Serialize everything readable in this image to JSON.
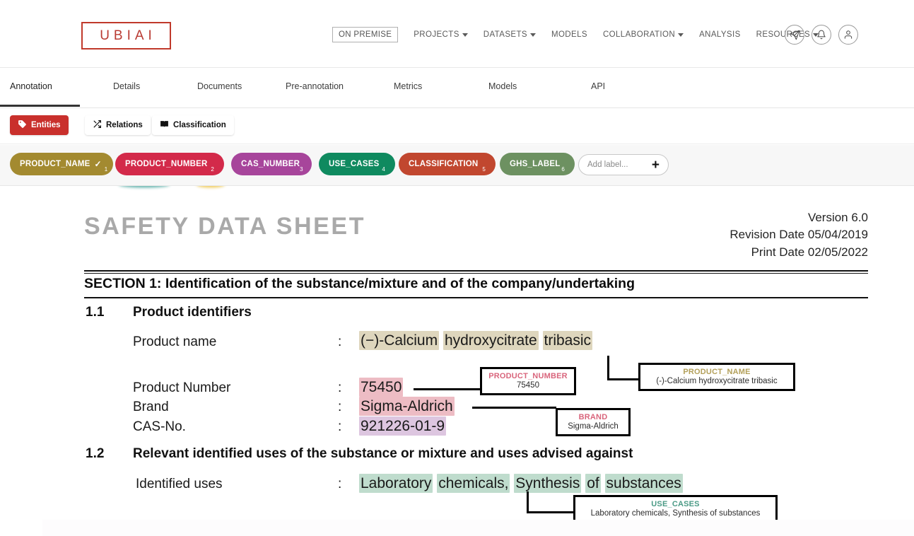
{
  "brand": {
    "name": "UBIAI",
    "color": "#b93b33"
  },
  "topnav": {
    "badge": "ON PREMISE",
    "items": [
      {
        "label": "PROJECTS",
        "caret": true
      },
      {
        "label": "DATASETS",
        "caret": true
      },
      {
        "label": "MODELS",
        "caret": false
      },
      {
        "label": "COLLABORATION",
        "caret": true
      },
      {
        "label": "ANALYSIS",
        "caret": false
      },
      {
        "label": "RESOURCES",
        "caret": true
      }
    ],
    "icons": [
      "send-icon",
      "bell-icon",
      "user-icon"
    ]
  },
  "tabs": {
    "items": [
      {
        "label": "Annotation",
        "active": true
      },
      {
        "label": "Details",
        "active": false
      },
      {
        "label": "Documents",
        "active": false
      },
      {
        "label": "Pre-annotation",
        "active": false
      },
      {
        "label": "Metrics",
        "active": false
      },
      {
        "label": "Models",
        "active": false
      },
      {
        "label": "API",
        "active": false
      }
    ]
  },
  "modebar": {
    "entities": "Entities",
    "relations": "Relations",
    "classification": "Classification"
  },
  "labels": {
    "chips": [
      {
        "name": "PRODUCT_NAME",
        "num": "1",
        "color": "#a38a30",
        "check": "✓"
      },
      {
        "name": "PRODUCT_NUMBER",
        "num": "2",
        "color": "#d32a4a",
        "check": ""
      },
      {
        "name": "CAS_NUMBER",
        "num": "3",
        "color": "#a7459b",
        "check": ""
      },
      {
        "name": "USE_CASES",
        "num": "4",
        "color": "#0f8a5f",
        "check": ""
      },
      {
        "name": "CLASSIFICATION",
        "num": "5",
        "color": "#c1472f",
        "check": ""
      },
      {
        "name": "GHS_LABEL",
        "num": "6",
        "color": "#6d9161",
        "check": ""
      }
    ],
    "add_placeholder": "Add label...",
    "add_plus": "+"
  },
  "document": {
    "title": "SAFETY DATA SHEET",
    "version": "Version 6.0",
    "revision_date": "Revision Date 05/04/2019",
    "print_date": "Print Date 02/05/2022",
    "section1_heading": "SECTION 1: Identification of the substance/mixture and of the company/undertaking",
    "sub11_num": "1.1",
    "sub11_title": "Product identifiers",
    "sub12_num": "1.2",
    "sub12_title": "Relevant identified uses of the substance or mixture and uses advised against",
    "colon": ":",
    "fields": [
      {
        "label": "Product name",
        "value": "(−)-Calcium hydroxycitrate tribasic"
      },
      {
        "label": "Product Number",
        "value": "75450"
      },
      {
        "label": "Brand",
        "value": "Sigma-Aldrich"
      },
      {
        "label": "CAS-No.",
        "value": "921226-01-9"
      },
      {
        "label": "Identified uses",
        "value": "Laboratory chemicals, Synthesis of substances"
      }
    ],
    "product_name_tokens": [
      "(−)-Calcium",
      "hydroxycitrate",
      "tribasic"
    ],
    "use_cases_tokens": [
      "Laboratory",
      "chemicals,",
      "Synthesis",
      "of",
      "substances"
    ]
  },
  "callouts": [
    {
      "name": "PRODUCT_NUMBER",
      "value": "75450",
      "color": "#d9657c"
    },
    {
      "name": "PRODUCT_NAME",
      "value": "(-)-Calcium hydroxycitrate tribasic",
      "color": "#b3a05a"
    },
    {
      "name": "BRAND",
      "value": "Sigma-Aldrich",
      "color": "#d9657c"
    },
    {
      "name": "USE_CASES",
      "value": "Laboratory chemicals, Synthesis of substances",
      "color": "#4b9b86"
    }
  ],
  "highlight_colors": {
    "product_name": "#ded6bd",
    "product_number": "#edbcc4",
    "brand": "#edbcc4",
    "cas_number": "#ddc6e0",
    "use_cases": "#bfdccd"
  }
}
